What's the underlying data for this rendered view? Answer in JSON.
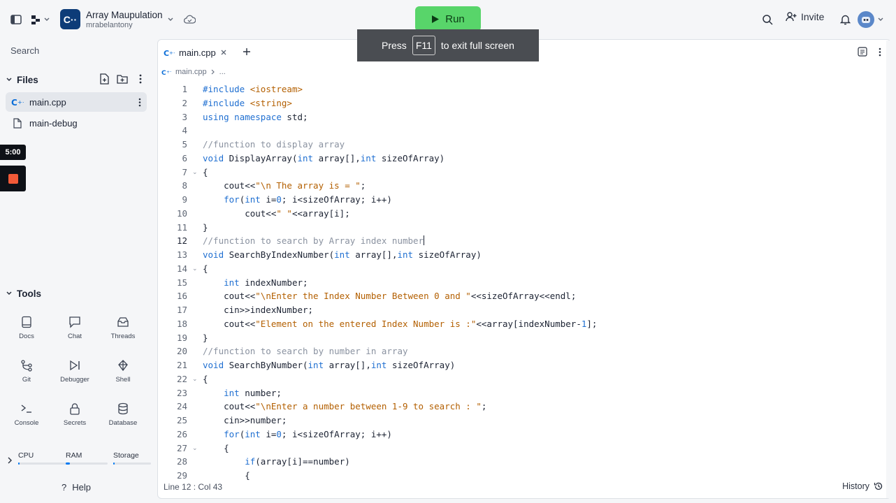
{
  "topbar": {
    "repl_name": "Array Maupulation",
    "owner": "mrabelantony",
    "run_label": "Run",
    "invite_label": "Invite",
    "logo_text": "C··"
  },
  "toast": {
    "press": "Press",
    "key": "F11",
    "suffix": "to exit full screen"
  },
  "sidebar": {
    "search_label": "Search",
    "files_title": "Files",
    "files": [
      {
        "name": "main.cpp",
        "icon": "cpp-icon",
        "active": true
      },
      {
        "name": "main-debug",
        "icon": "file-icon",
        "active": false
      }
    ],
    "timer": "5:00",
    "tools_title": "Tools",
    "tools": [
      {
        "label": "Docs",
        "icon": "docs-icon"
      },
      {
        "label": "Chat",
        "icon": "chat-icon"
      },
      {
        "label": "Threads",
        "icon": "threads-icon"
      },
      {
        "label": "Git",
        "icon": "git-icon"
      },
      {
        "label": "Debugger",
        "icon": "debugger-icon"
      },
      {
        "label": "Shell",
        "icon": "shell-icon"
      },
      {
        "label": "Console",
        "icon": "console-icon"
      },
      {
        "label": "Secrets",
        "icon": "lock-icon"
      },
      {
        "label": "Database",
        "icon": "database-icon"
      }
    ],
    "resources": [
      {
        "label": "CPU",
        "level": 0.02
      },
      {
        "label": "RAM",
        "level": 0.1
      },
      {
        "label": "Storage",
        "level": 0.02
      }
    ],
    "help_label": "Help"
  },
  "editor": {
    "tab_name": "main.cpp",
    "breadcrumb_file": "main.cpp",
    "breadcrumb_more": "...",
    "status": "Line 12 : Col 43",
    "history_label": "History",
    "accent": "#0079f2",
    "lines": [
      "#include <iostream>",
      "#include <string>",
      "using namespace std;",
      "",
      "//function to display array",
      "void DisplayArray(int array[],int sizeOfArray)",
      "{",
      "    cout<<\"\\n The array is = \";",
      "    for(int i=0; i<sizeOfArray; i++)",
      "        cout<<\" \"<<array[i];",
      "}",
      "//function to search by Array index number",
      "void SearchByIndexNumber(int array[],int sizeOfArray)",
      "{",
      "    int indexNumber;",
      "    cout<<\"\\nEnter the Index Number Between 0 and \"<<sizeOfArray<<endl;",
      "    cin>>indexNumber;",
      "    cout<<\"Element on the entered Index Number is :\"<<array[indexNumber-1];",
      "}",
      "//function to search by number in array",
      "void SearchByNumber(int array[],int sizeOfArray)",
      "{",
      "    int number;",
      "    cout<<\"\\nEnter a number between 1-9 to search : \";",
      "    cin>>number;",
      "    for(int i=0; i<sizeOfArray; i++)",
      "    {",
      "        if(array[i]==number)",
      "        {"
    ],
    "line_numbers": [
      "1",
      "2",
      "3",
      "4",
      "5",
      "6",
      "7",
      "8",
      "9",
      "10",
      "11",
      "12",
      "13",
      "14",
      "15",
      "16",
      "17",
      "18",
      "19",
      "20",
      "21",
      "22",
      "23",
      "24",
      "25",
      "26",
      "27",
      "28",
      "29"
    ],
    "current_line": 12,
    "fold_lines": [
      7,
      14,
      22,
      27
    ]
  }
}
